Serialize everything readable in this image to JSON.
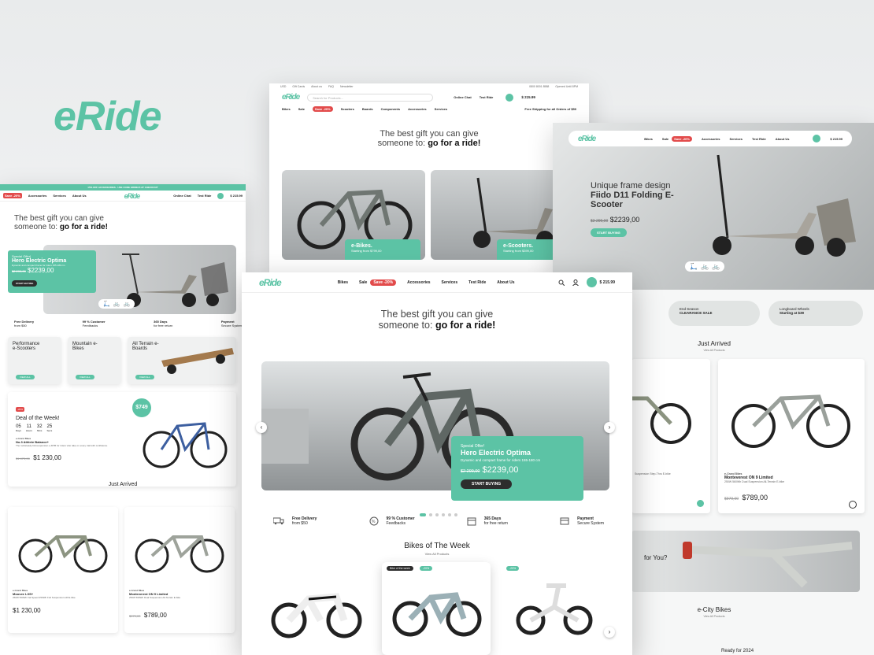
{
  "brand": {
    "name": "eRide"
  },
  "colors": {
    "accent": "#5cc3a5",
    "dark": "#2d2d2d",
    "sale": "#e24b4b"
  },
  "nav": {
    "items": [
      "Bikes",
      "Sale",
      "Accessories",
      "Services",
      "Test Ride",
      "About Us"
    ],
    "sale_badge": "Save -20%",
    "cart_total": "$ 215.99",
    "top_items": [
      "Bikes",
      "Sale",
      "Scooters",
      "Boards",
      "Components",
      "Accessories",
      "Services"
    ],
    "free_shipping": "Free Shipping for all Orders of $50",
    "search_placeholder": "Search for Products...",
    "online_chat": "Online Chat",
    "online_chat_sub": "With us",
    "test_ride": "Test Ride",
    "test_ride_sub": "Before Buy",
    "top_links": [
      "USD",
      "Gift Cards",
      "About us",
      "FAQ",
      "Newsletter"
    ],
    "phone": "0800 8001 8588",
    "hours": "Opened Until 8PM"
  },
  "hero": {
    "line1": "The best gift you can give",
    "line2_pre": "someone to:",
    "line2_bold": "go for a ride!",
    "special_label": "Special Offer!",
    "special_title": "Hero Electric Optima",
    "special_desc": "Dynamic and compact frame for riders 155-180 cm",
    "old_price": "$2 299,00",
    "price": "$2239,00",
    "cta": "START BUYING"
  },
  "top_cards": [
    {
      "title": "e-Bikes.",
      "sub": "Starting from $799,00"
    },
    {
      "title": "e-Scooters.",
      "sub": "Starting from $399,00"
    }
  ],
  "right_hero": {
    "line1": "Unique frame",
    "line2": "design",
    "bold": "Fiido D11 Folding E-Scooter",
    "old_price": "$2 299,00",
    "price": "$2239,00",
    "cta": "START BUYING"
  },
  "right_promos": [
    {
      "title": "End Season",
      "bold": "CLEARANCE SALE"
    },
    {
      "title": "Longboard Wheels",
      "bold": "Starting at $39"
    }
  ],
  "just_arrived": {
    "title": "Just Arrived",
    "link": "View All Products"
  },
  "right_products": [
    {
      "brand": "e-Grand Bikes",
      "name": "Monteverest ON 9 Limited",
      "desc": "250W 560Wh Dual Suspension All-Terrain E-bike",
      "old": "$979,00",
      "price": "$789,00"
    }
  ],
  "right_partial_desc": "Suspension Step-Thru E-bike",
  "right_question": "for You?",
  "ecity": {
    "title": "e-City Bikes",
    "link": "View All Products",
    "ready": "Ready for 2024"
  },
  "features": [
    {
      "icon": "truck-icon",
      "title": "Free Delivery",
      "sub": "from $50"
    },
    {
      "icon": "percent-icon",
      "title": "99 % Customer",
      "sub": "Feedbacks"
    },
    {
      "icon": "calendar-icon",
      "title": "365 Days",
      "sub": "for free return"
    },
    {
      "icon": "card-icon",
      "title": "Payment",
      "sub": "Secure System"
    }
  ],
  "bikes_week": {
    "title": "Bikes of The Week",
    "link": "View All Products",
    "badge": "Bike of the week",
    "discount": "-20%"
  },
  "left": {
    "promo_bar": "15% OFF ACCESSORIES · USE CODE ERIDE15 AT CHECKOUT",
    "categories": [
      {
        "title": "Performance e-Scooters",
        "btn": "VIEW ALL"
      },
      {
        "title": "Mountain e-Bikes",
        "btn": "VIEW ALL"
      },
      {
        "title": "All Terrain e-Boards",
        "btn": "VIEW ALL"
      }
    ],
    "deal": {
      "badge": "-20%",
      "title": "Deal of the Week!",
      "countdown": [
        {
          "num": "05",
          "lab": "Days"
        },
        {
          "num": "11",
          "lab": "Hours"
        },
        {
          "num": "32",
          "lab": "Mins"
        },
        {
          "num": "25",
          "lab": "Secs"
        }
      ],
      "brand": "e-Grand Bikes",
      "name": "No.3 Athlete Balance+",
      "desc": "The rocksteady full-suspension e-MTB for riders who take on every trail with confidence.",
      "old": "$1 470,00",
      "price": "$1 230,00",
      "price_tag": "$749",
      "save_label": "SAVE"
    },
    "products": [
      {
        "brand": "e-Grand Bikes",
        "name": "Moovee LXS+",
        "desc": "250W 560Wh Fat Speed 250Wh Full Suspension Hill E-bike",
        "old": "",
        "price": "$1 230,00"
      },
      {
        "brand": "e-Grand Bikes",
        "name": "Monteverest ON 9 Limited",
        "desc": "250W 560Wh Dual Suspension All-Terrain E-bike",
        "old": "$979,00",
        "price": "$789,00"
      }
    ]
  }
}
